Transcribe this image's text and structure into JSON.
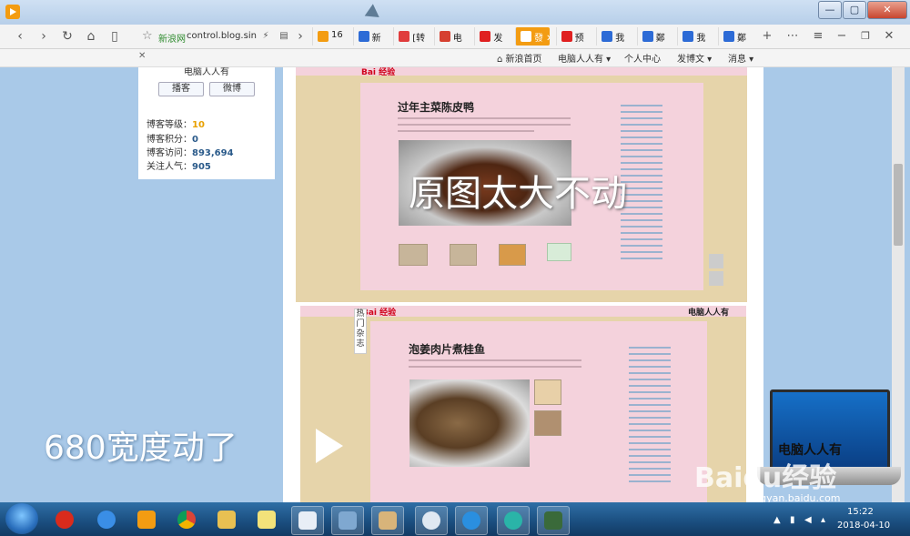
{
  "browser": {
    "url_site": "新浪网",
    "url_text": "control.blog.sin",
    "tabs": [
      {
        "label": "16",
        "color": "#f39c12",
        "active": false
      },
      {
        "label": "新",
        "color": "#2d6bd6",
        "active": false
      },
      {
        "label": "[转",
        "color": "#e03c3c",
        "active": false
      },
      {
        "label": "电",
        "color": "#d64030",
        "active": false
      },
      {
        "label": "发",
        "color": "#e02020",
        "active": false
      },
      {
        "label": "發",
        "color": "#ffffff",
        "active": true
      },
      {
        "label": "预",
        "color": "#e02020",
        "active": false
      },
      {
        "label": "我",
        "color": "#2d6bd6",
        "active": false
      },
      {
        "label": "鄭",
        "color": "#2d6bd6",
        "active": false
      },
      {
        "label": "我",
        "color": "#2d6bd6",
        "active": false
      },
      {
        "label": "鄭",
        "color": "#2d6bd6",
        "active": false
      }
    ]
  },
  "blog_toolbar": {
    "home": "新浪首页",
    "user": "电脑人人有",
    "personal": "个人中心",
    "post": "发博文",
    "messages": "消息"
  },
  "profile": {
    "name": "电脑人人有",
    "btn_broadcast": "播客",
    "btn_weibo": "微博",
    "level_label": "博客等级：",
    "level_value": "10",
    "points_label": "博客积分：",
    "points_value": "0",
    "visits_label": "博客访问：",
    "visits_value": "893,694",
    "popularity_label": "关注人气：",
    "popularity_value": "905"
  },
  "article1": {
    "title": "过年主菜陈皮鸭",
    "overlay": "原图太大不动"
  },
  "article2": {
    "title": "泡姜肉片煮桂鱼",
    "header_right": "电脑人人有"
  },
  "hot": "热门杂志",
  "caption": "680宽度动了",
  "watermark": {
    "laptop_text": "电脑人人有",
    "baidu": "Baidu经验",
    "url": "jingyan.baidu.com"
  },
  "clock": {
    "time": "15:22",
    "date": "2018-04-10"
  }
}
